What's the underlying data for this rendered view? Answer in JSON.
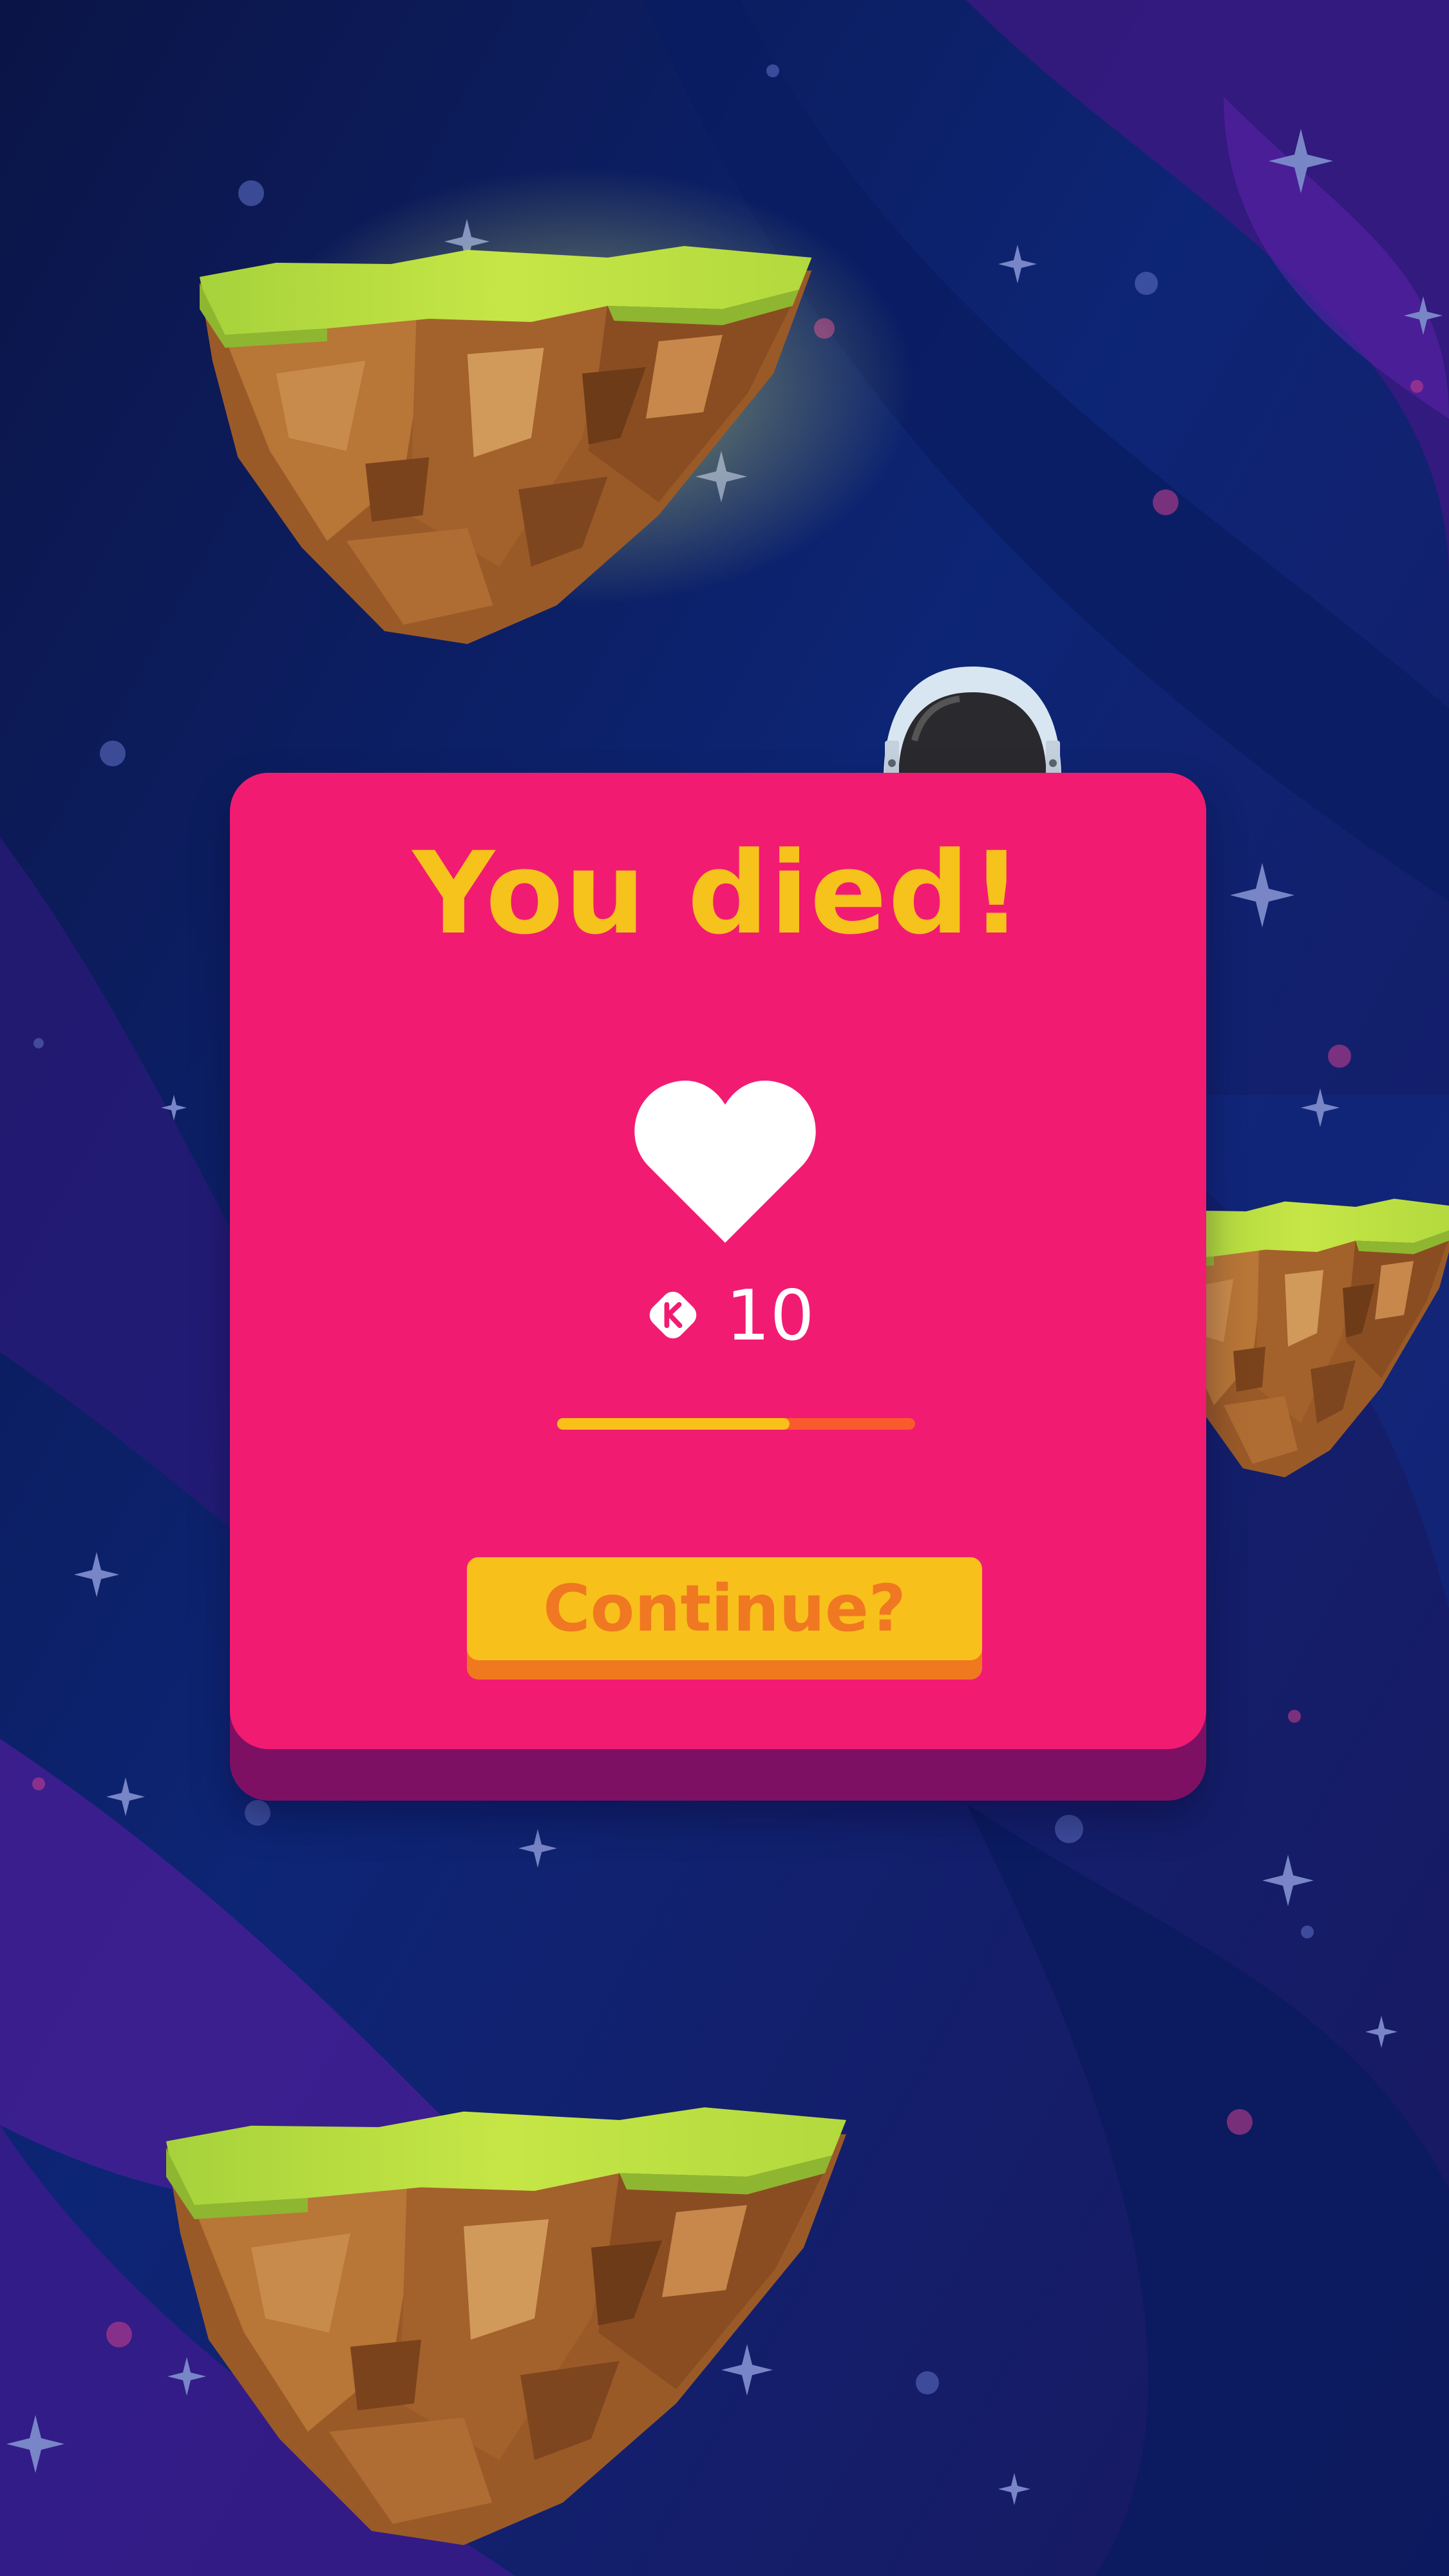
{
  "dialog": {
    "title": "You died!",
    "lives_icon": "heart-icon",
    "currency_icon": "k-token-icon",
    "lives_count": "10",
    "progress": 0.65,
    "continue_label": "Continue?"
  },
  "colors": {
    "dialog": "#f21b72",
    "dialog_shadow": "#7e1064",
    "title": "#f6c21c",
    "button": "#f8c01b",
    "button_shadow": "#f0791f",
    "button_text": "#f07822",
    "progress_fill": "#f9c01a",
    "progress_track": "#fb5a2e",
    "space_dark": "#0a1850",
    "space_purple": "#4a1a8c",
    "grass": "#b8e040",
    "rock": "#a9652f"
  }
}
